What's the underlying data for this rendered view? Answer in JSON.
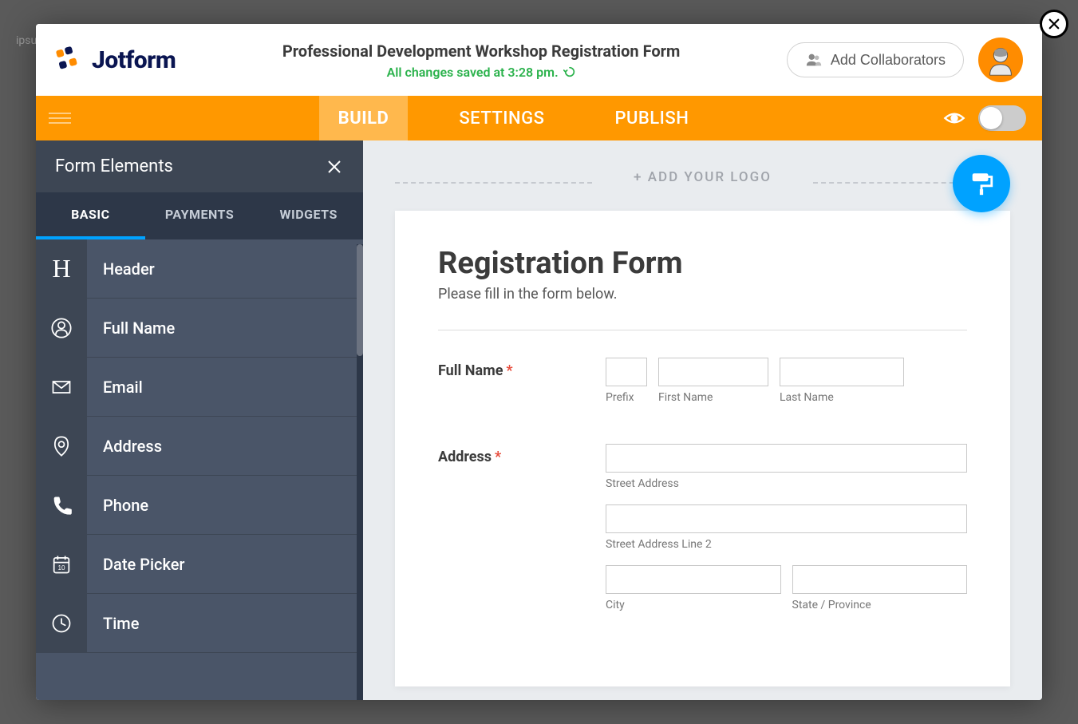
{
  "brand": {
    "name": "Jotform"
  },
  "header": {
    "form_title": "Professional Development Workshop Registration Form",
    "save_status": "All changes saved at 3:28 pm.",
    "collab_label": "Add Collaborators"
  },
  "main_tabs": [
    {
      "label": "BUILD",
      "active": true
    },
    {
      "label": "SETTINGS",
      "active": false
    },
    {
      "label": "PUBLISH",
      "active": false
    }
  ],
  "sidebar": {
    "title": "Form Elements",
    "tabs": [
      {
        "label": "BASIC",
        "active": true
      },
      {
        "label": "PAYMENTS",
        "active": false
      },
      {
        "label": "WIDGETS",
        "active": false
      }
    ],
    "elements": [
      {
        "label": "Header",
        "icon": "header"
      },
      {
        "label": "Full Name",
        "icon": "person"
      },
      {
        "label": "Email",
        "icon": "email"
      },
      {
        "label": "Address",
        "icon": "location"
      },
      {
        "label": "Phone",
        "icon": "phone"
      },
      {
        "label": "Date Picker",
        "icon": "date"
      },
      {
        "label": "Time",
        "icon": "time"
      }
    ]
  },
  "canvas": {
    "logo_prompt": "+ ADD YOUR LOGO",
    "form_heading": "Registration Form",
    "form_subtitle": "Please fill in the form below.",
    "fields": {
      "fullname": {
        "label": "Full Name",
        "required": true,
        "sub": {
          "prefix": "Prefix",
          "first": "First Name",
          "last": "Last Name"
        }
      },
      "address": {
        "label": "Address",
        "required": true,
        "sub": {
          "street1": "Street Address",
          "street2": "Street Address Line 2",
          "city": "City",
          "state": "State / Province"
        }
      }
    }
  },
  "colors": {
    "accent_orange": "#ff9800",
    "accent_blue": "#00a2ff",
    "success": "#2bb24c"
  }
}
